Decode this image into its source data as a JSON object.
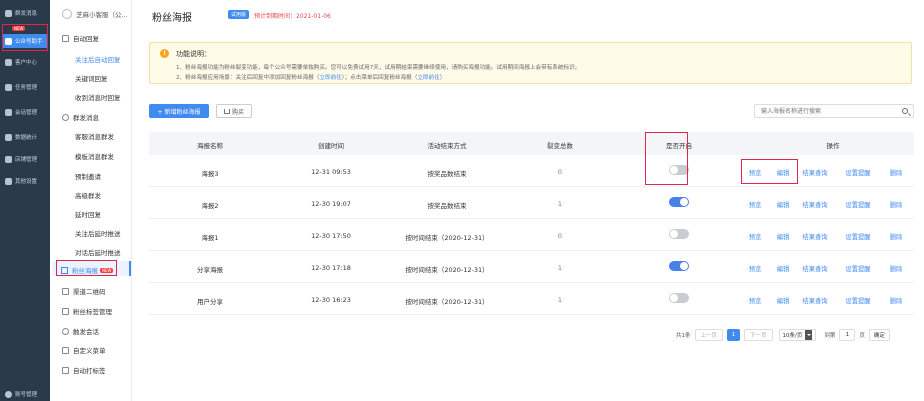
{
  "nav": {
    "items": [
      {
        "label": "群发消息",
        "icon": "send-icon"
      },
      {
        "label": "公众号助手",
        "icon": "assistant-icon",
        "badge": "NEW"
      },
      {
        "label": "客户中心",
        "icon": "customer-icon"
      },
      {
        "label": "任务管理",
        "icon": "task-icon"
      },
      {
        "label": "会话管理",
        "icon": "chat-icon"
      },
      {
        "label": "数据统计",
        "icon": "stats-icon"
      },
      {
        "label": "店铺管理",
        "icon": "shop-icon"
      },
      {
        "label": "其他设置",
        "icon": "settings-icon"
      }
    ],
    "footer": "账号管理"
  },
  "submenu": {
    "account": "芝麻小客服（公...",
    "auto_reply": "自动回复",
    "auto_reply_items": [
      "关注后自动回复",
      "关键词回复",
      "收到消息时回复"
    ],
    "mass": "群发消息",
    "mass_items": [
      "客服消息群发",
      "模板消息群发",
      "预制邀请",
      "高级群发",
      "延时回复",
      "关注后延时推送",
      "对话后延时推送"
    ],
    "poster": "粉丝海报",
    "poster_badge": "NEW",
    "others": [
      "渠道二维码",
      "粉丝标签管理",
      "触发会话",
      "自定义菜单",
      "自动打标签"
    ]
  },
  "header": {
    "title": "粉丝海报",
    "trial": "试用版",
    "expire": "预计到期时间：2021-01-06"
  },
  "notice": {
    "title": "功能说明：",
    "line1": "1、粉丝海报功能为粉丝裂变功能，每个公众号需要单独购买。您可以免费试用7天，试用期结束需要继续使用，请购买海报功能。试用期间海报上会带有系统标识。",
    "line2_a": "2、粉丝海报应用场景：关注后回复中添加回复粉丝海报（",
    "line2_link1": "立即前往",
    "line2_b": "）；点击菜单后回复粉丝海报（",
    "line2_link2": "立即前往",
    "line2_c": "）"
  },
  "toolbar": {
    "new_label": "+ 新增粉丝海报",
    "buy_label": "购买",
    "search_placeholder": "输入海报名称进行搜索"
  },
  "table": {
    "headers": [
      "海报名称",
      "创建时间",
      "活动结束方式",
      "裂变总数",
      "是否开启",
      "操作"
    ],
    "rows": [
      {
        "name": "海报3",
        "time": "12-31 09:53",
        "mode": "按奖品数结束",
        "count": "0",
        "enabled": false
      },
      {
        "name": "海报2",
        "time": "12-30 19:07",
        "mode": "按奖品数结束",
        "count": "1",
        "enabled": true
      },
      {
        "name": "海报1",
        "time": "12-30 17:50",
        "mode": "按时间结束（2020-12-31）",
        "count": "0",
        "enabled": false
      },
      {
        "name": "分享海报",
        "time": "12-30 17:18",
        "mode": "按时间结束（2020-12-31）",
        "count": "1",
        "enabled": true
      },
      {
        "name": "用户分享",
        "time": "12-30 16:23",
        "mode": "按时间结束（2020-12-31）",
        "count": "1",
        "enabled": false
      }
    ],
    "ops": [
      "预览",
      "编辑",
      "结果查询",
      "设置提醒",
      "删除"
    ]
  },
  "pager": {
    "total": "共1条",
    "prev": "上一页",
    "page": "1",
    "next": "下一页",
    "per_page": "10条/页",
    "goto": "到第",
    "goto_value": "1",
    "unit": "页",
    "confirm": "确定"
  }
}
